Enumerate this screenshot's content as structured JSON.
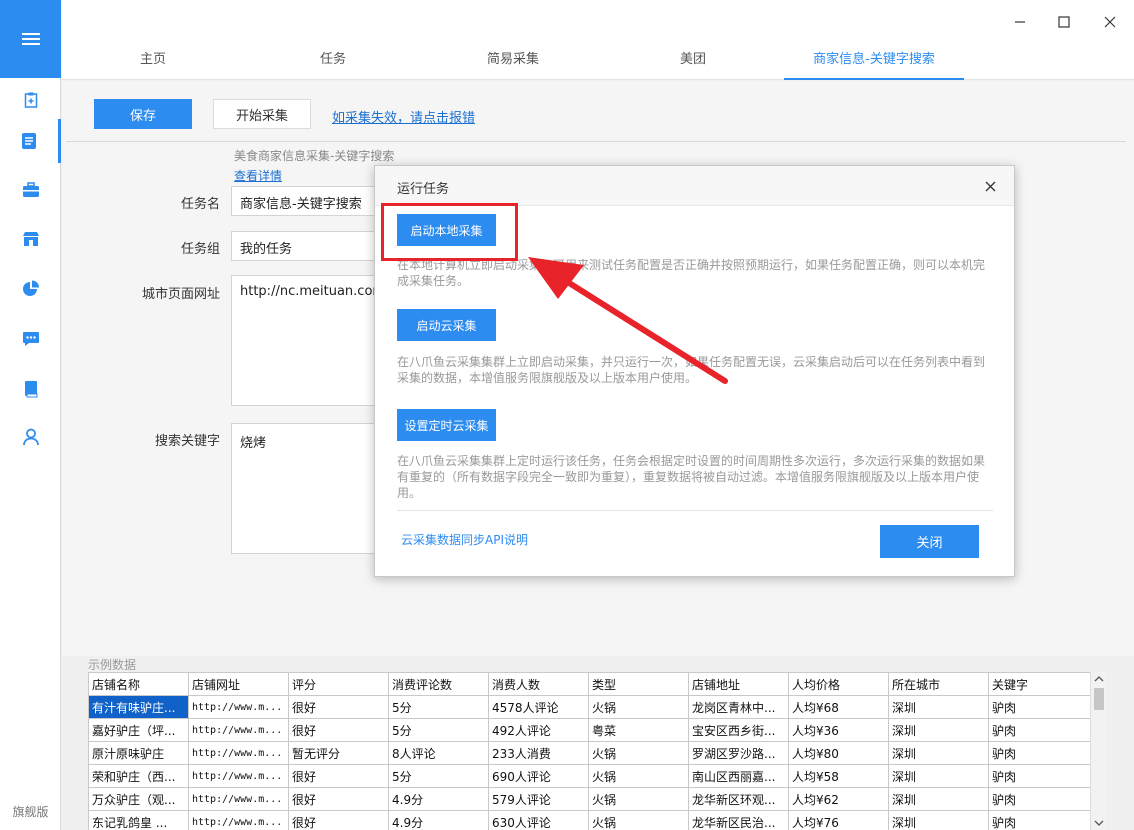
{
  "app": {
    "edition_label": "旗舰版"
  },
  "window": {
    "minimize_icon": "minimize-icon",
    "maximize_icon": "maximize-icon",
    "close_icon": "close-icon"
  },
  "sidebar": {
    "items": [
      {
        "icon": "task-add-icon"
      },
      {
        "icon": "document-icon"
      },
      {
        "icon": "toolbox-icon"
      },
      {
        "icon": "store-icon"
      },
      {
        "icon": "pie-chart-icon"
      },
      {
        "icon": "chat-icon"
      },
      {
        "icon": "book-icon"
      },
      {
        "icon": "user-icon"
      }
    ]
  },
  "tabs": [
    {
      "label": "主页"
    },
    {
      "label": "任务"
    },
    {
      "label": "简易采集"
    },
    {
      "label": "美团"
    },
    {
      "label": "商家信息-关键字搜索"
    }
  ],
  "toolbar": {
    "save_label": "保存",
    "start_label": "开始采集",
    "report_link": "如采集失效，请点击报错"
  },
  "template": {
    "description": "美食商家信息采集-关键字搜索",
    "details_link": "查看详情"
  },
  "form": {
    "task_name_label": "任务名",
    "task_name_value": "商家信息-关键字搜索",
    "task_group_label": "任务组",
    "task_group_value": "我的任务",
    "city_url_label": "城市页面网址",
    "city_url_value": "http://nc.meituan.com",
    "keyword_label": "搜索关键字",
    "keyword_value": "烧烤"
  },
  "modal": {
    "title": "运行任务",
    "local_button": "启动本地采集",
    "local_desc": "在本地计算机立即启动采集，可用来测试任务配置是否正确并按照预期运行，如果任务配置正确，则可以本机完成采集任务。",
    "cloud_button": "启动云采集",
    "cloud_desc": "在八爪鱼云采集集群上立即启动采集，并只运行一次，如果任务配置无误，云采集启动后可以在任务列表中看到采集的数据，本增值服务限旗舰版及以上版本用户使用。",
    "schedule_button": "设置定时云采集",
    "schedule_desc": "在八爪鱼云采集集群上定时运行该任务，任务会根据定时设置的时间周期性多次运行，多次运行采集的数据如果有重复的（所有数据字段完全一致即为重复），重复数据将被自动过滤。本增值服务限旗舰版及以上版本用户使用。",
    "api_link": "云采集数据同步API说明",
    "close_button": "关闭"
  },
  "sample": {
    "title": "示例数据",
    "columns": [
      "店铺名称",
      "店铺网址",
      "评分",
      "消费评论数",
      "消费人数",
      "类型",
      "店铺地址",
      "人均价格",
      "所在城市",
      "关键字"
    ],
    "rows": [
      [
        "有汁有味驴庄...",
        "http://www.m...",
        "很好",
        "5分",
        "4578人评论",
        "火锅",
        "龙岗区青林中...",
        "人均¥68",
        "深圳",
        "驴肉"
      ],
      [
        "嘉好驴庄（坪...",
        "http://www.m...",
        "很好",
        "5分",
        "492人评论",
        "粤菜",
        "宝安区西乡街...",
        "人均¥36",
        "深圳",
        "驴肉"
      ],
      [
        "原汁原味驴庄",
        "http://www.m...",
        "暂无评分",
        "8人评论",
        "233人消费",
        "火锅",
        "罗湖区罗沙路...",
        "人均¥80",
        "深圳",
        "驴肉"
      ],
      [
        "荣和驴庄（西...",
        "http://www.m...",
        "很好",
        "5分",
        "690人评论",
        "火锅",
        "南山区西丽嘉...",
        "人均¥58",
        "深圳",
        "驴肉"
      ],
      [
        "万众驴庄（观...",
        "http://www.m...",
        "很好",
        "4.9分",
        "579人评论",
        "火锅",
        "龙华新区环观...",
        "人均¥62",
        "深圳",
        "驴肉"
      ],
      [
        "东记乳鸽皇 ...",
        "http://www.m...",
        "很好",
        "4.9分",
        "630人评论",
        "火锅",
        "龙华新区民治...",
        "人均¥76",
        "深圳",
        "驴肉"
      ]
    ]
  }
}
